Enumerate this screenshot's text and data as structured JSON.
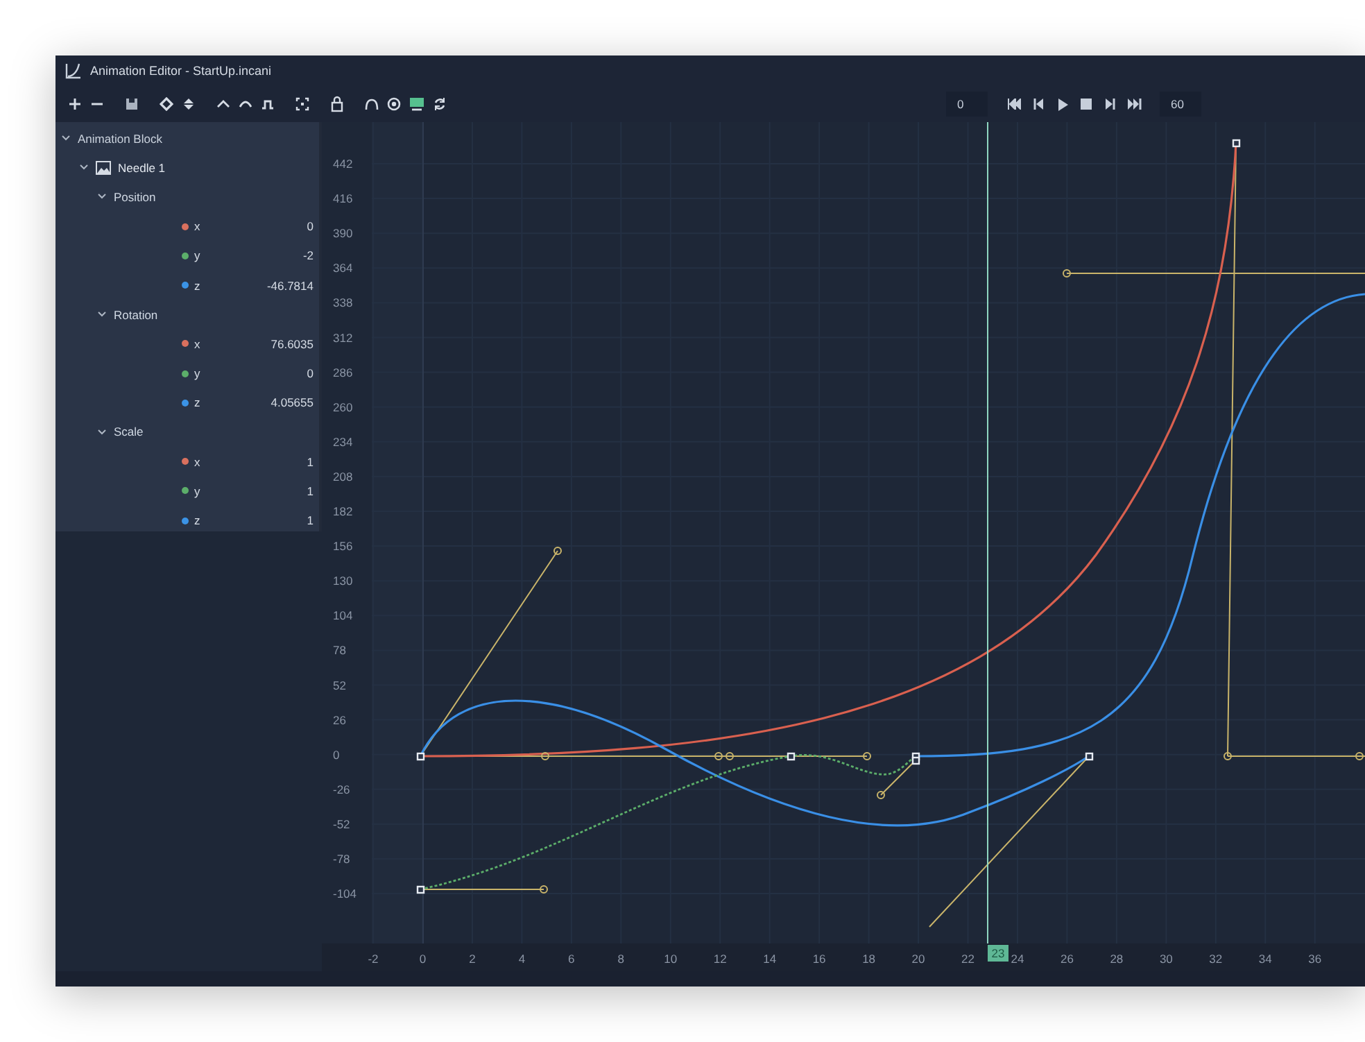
{
  "window": {
    "title": "Animation Editor - StartUp.incani"
  },
  "playback": {
    "start_frame": "0",
    "end_frame": "60"
  },
  "tree": [
    {
      "kind": "block",
      "label": "Animation Block",
      "expanded": true,
      "children": [
        {
          "kind": "object",
          "label": "Needle 1",
          "expanded": true,
          "children": [
            {
              "kind": "group",
              "label": "Position",
              "expanded": true,
              "children": [
                {
                  "kind": "channel",
                  "label": "x",
                  "value": "0",
                  "color": "#d9705e"
                },
                {
                  "kind": "channel",
                  "label": "y",
                  "value": "-2",
                  "color": "#5cae6a"
                },
                {
                  "kind": "channel",
                  "label": "z",
                  "value": "-46.7814",
                  "color": "#3b93e6"
                }
              ]
            },
            {
              "kind": "group",
              "label": "Rotation",
              "expanded": true,
              "children": [
                {
                  "kind": "channel",
                  "label": "x",
                  "value": "76.6035",
                  "color": "#d9705e"
                },
                {
                  "kind": "channel",
                  "label": "y",
                  "value": "0",
                  "color": "#5cae6a"
                },
                {
                  "kind": "channel",
                  "label": "z",
                  "value": "4.05655",
                  "color": "#3b93e6"
                }
              ]
            },
            {
              "kind": "group",
              "label": "Scale",
              "expanded": true,
              "children": [
                {
                  "kind": "channel",
                  "label": "x",
                  "value": "1",
                  "color": "#d9705e"
                },
                {
                  "kind": "channel",
                  "label": "y",
                  "value": "1",
                  "color": "#5cae6a"
                },
                {
                  "kind": "channel",
                  "label": "z",
                  "value": "1",
                  "color": "#3b93e6"
                }
              ]
            }
          ]
        }
      ]
    }
  ],
  "graph": {
    "y_ticks": [
      "442",
      "416",
      "390",
      "364",
      "338",
      "312",
      "286",
      "260",
      "234",
      "208",
      "182",
      "156",
      "130",
      "104",
      "78",
      "52",
      "26",
      "0",
      "-26",
      "-52",
      "-78",
      "-104"
    ],
    "x_ticks": [
      "-2",
      "0",
      "2",
      "4",
      "6",
      "8",
      "10",
      "12",
      "14",
      "16",
      "18",
      "20",
      "22",
      "24",
      "26",
      "28",
      "30",
      "32",
      "34",
      "36"
    ],
    "playhead": "23"
  }
}
